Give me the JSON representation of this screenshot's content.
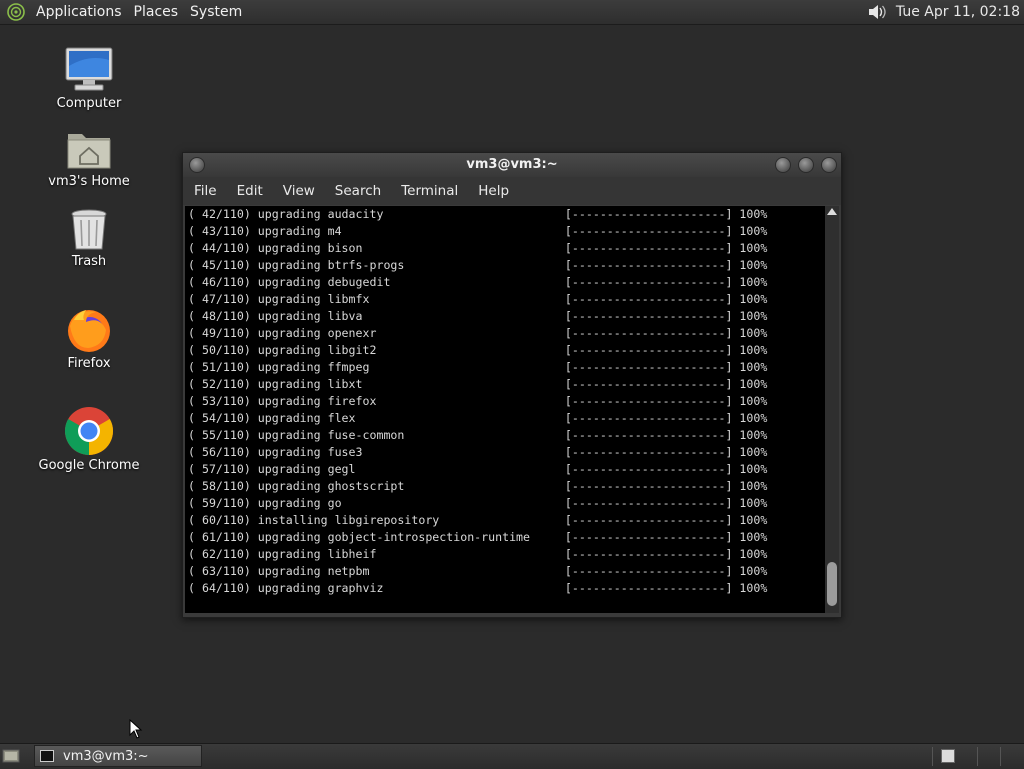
{
  "top_panel": {
    "menus": [
      "Applications",
      "Places",
      "System"
    ],
    "clock": "Tue Apr 11, 02:18",
    "icons": {
      "logo": "distro-logo-icon",
      "volume": "volume-icon"
    }
  },
  "desktop_icons": [
    {
      "label": "Computer",
      "icon": "computer-icon"
    },
    {
      "label": "vm3's Home",
      "icon": "home-folder-icon"
    },
    {
      "label": "Trash",
      "icon": "trash-icon"
    },
    {
      "label": "Firefox",
      "icon": "firefox-icon"
    },
    {
      "label": "Google Chrome",
      "icon": "chrome-icon"
    }
  ],
  "terminal": {
    "title": "vm3@vm3:~",
    "menu": [
      "File",
      "Edit",
      "View",
      "Search",
      "Terminal",
      "Help"
    ],
    "lines": [
      "( 42/110) upgrading audacity                          [----------------------] 100%",
      "( 43/110) upgrading m4                                [----------------------] 100%",
      "( 44/110) upgrading bison                             [----------------------] 100%",
      "( 45/110) upgrading btrfs-progs                       [----------------------] 100%",
      "( 46/110) upgrading debugedit                         [----------------------] 100%",
      "( 47/110) upgrading libmfx                            [----------------------] 100%",
      "( 48/110) upgrading libva                             [----------------------] 100%",
      "( 49/110) upgrading openexr                           [----------------------] 100%",
      "( 50/110) upgrading libgit2                           [----------------------] 100%",
      "( 51/110) upgrading ffmpeg                            [----------------------] 100%",
      "( 52/110) upgrading libxt                             [----------------------] 100%",
      "( 53/110) upgrading firefox                           [----------------------] 100%",
      "( 54/110) upgrading flex                              [----------------------] 100%",
      "( 55/110) upgrading fuse-common                       [----------------------] 100%",
      "( 56/110) upgrading fuse3                             [----------------------] 100%",
      "( 57/110) upgrading gegl                              [----------------------] 100%",
      "( 58/110) upgrading ghostscript                       [----------------------] 100%",
      "( 59/110) upgrading go                                [----------------------] 100%",
      "( 60/110) installing libgirepository                  [----------------------] 100%",
      "( 61/110) upgrading gobject-introspection-runtime     [----------------------] 100%",
      "( 62/110) upgrading libheif                           [----------------------] 100%",
      "( 63/110) upgrading netpbm                            [----------------------] 100%",
      "( 64/110) upgrading graphviz                          [----------------------] 100%"
    ]
  },
  "taskbar": {
    "task_label": "vm3@vm3:~",
    "icons": {
      "show_desktop": "show-desktop-icon",
      "task": "terminal-icon",
      "workspace": "workspace-switcher-icon"
    }
  }
}
